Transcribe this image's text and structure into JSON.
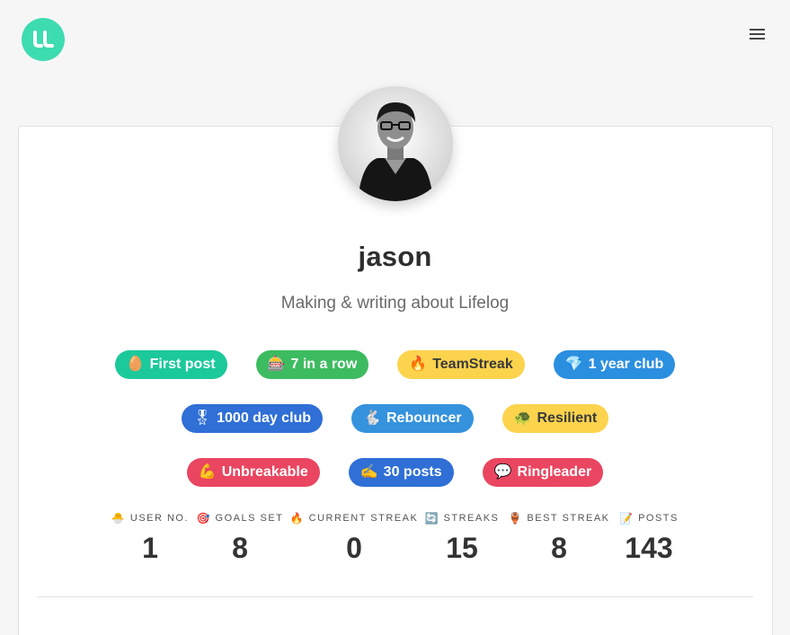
{
  "header": {
    "logo_text": "LL",
    "logo_color": "#3ddbb0",
    "menu_icon": "hamburger-icon"
  },
  "profile": {
    "name": "jason",
    "bio": "Making & writing about Lifelog"
  },
  "badges": [
    [
      {
        "emoji": "🥚",
        "label": "First post",
        "color": "#1cc99b"
      },
      {
        "emoji": "🎰",
        "label": "7 in a row",
        "color": "#3dbb60"
      },
      {
        "emoji": "🔥",
        "label": "TeamStreak",
        "color": "#fcd34d"
      },
      {
        "emoji": "💎",
        "label": "1 year club",
        "color": "#2b8fe0"
      }
    ],
    [
      {
        "emoji": "🎖",
        "label": "1000 day club",
        "color": "#2f6fd6"
      },
      {
        "emoji": "🐇",
        "label": "Rebouncer",
        "color": "#3592dd"
      },
      {
        "emoji": "🐢",
        "label": "Resilient",
        "color": "#fcd34d"
      }
    ],
    [
      {
        "emoji": "💪",
        "label": "Unbreakable",
        "color": "#ea4661"
      },
      {
        "emoji": "✍️",
        "label": "30 posts",
        "color": "#2f6fd6"
      },
      {
        "emoji": "💬",
        "label": "Ringleader",
        "color": "#ea4661"
      }
    ]
  ],
  "stats": [
    {
      "emoji": "🐣",
      "label": "USER NO.",
      "value": "1"
    },
    {
      "emoji": "🎯",
      "label": "GOALS SET",
      "value": "8"
    },
    {
      "emoji": "🔥",
      "label": "CURRENT STREAK",
      "value": "0"
    },
    {
      "emoji": "🔄",
      "label": "STREAKS",
      "value": "15"
    },
    {
      "emoji": "🏺",
      "label": "BEST STREAK",
      "value": "8"
    },
    {
      "emoji": "📝",
      "label": "POSTS",
      "value": "143"
    }
  ]
}
